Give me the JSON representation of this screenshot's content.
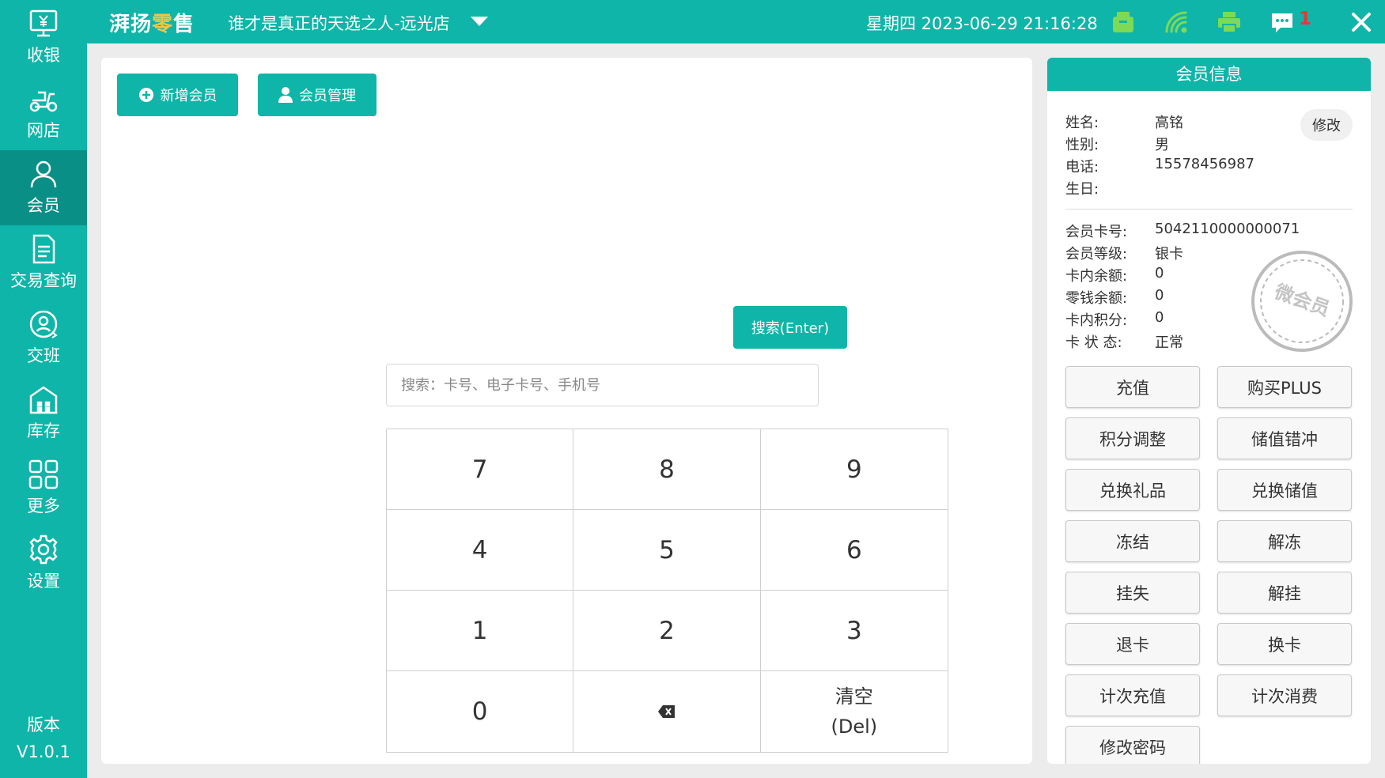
{
  "sidebar": {
    "items": [
      {
        "label": "收银",
        "icon": "cashier-monitor-icon"
      },
      {
        "label": "网店",
        "icon": "scooter-icon"
      },
      {
        "label": "会员",
        "icon": "member-person-icon",
        "active": true
      },
      {
        "label": "交易查询",
        "icon": "document-icon"
      },
      {
        "label": "交班",
        "icon": "shift-handover-icon"
      },
      {
        "label": "库存",
        "icon": "warehouse-icon"
      },
      {
        "label": "更多",
        "icon": "grid-icon"
      },
      {
        "label": "设置",
        "icon": "gear-icon"
      }
    ],
    "version_label": "版本",
    "version": "V1.0.1"
  },
  "header": {
    "brand": "湃扬零售",
    "store": "谁才是真正的天选之人-远光店",
    "datetime": "星期四 2023-06-29 21:16:28",
    "icons": [
      "cash-drawer-icon",
      "wifi-signal-icon",
      "printer-icon",
      "message-icon",
      "close-icon"
    ],
    "message_count": "1"
  },
  "main": {
    "add_member_label": "新增会员",
    "manage_member_label": "会员管理",
    "search_placeholder": "搜索：卡号、电子卡号、手机号",
    "search_button": "搜索(Enter)",
    "keypad": {
      "keys": [
        "7",
        "8",
        "9",
        "4",
        "5",
        "6",
        "1",
        "2",
        "3",
        "0"
      ],
      "clear_line1": "清空",
      "clear_line2": "(Del)"
    }
  },
  "member": {
    "title": "会员信息",
    "edit_label": "修改",
    "basic": [
      {
        "key": "姓名:",
        "value": "高铭"
      },
      {
        "key": "性别:",
        "value": "男"
      },
      {
        "key": "电话:",
        "value": "15578456987"
      },
      {
        "key": "生日:",
        "value": ""
      }
    ],
    "card": [
      {
        "key": "会员卡号:",
        "value": "5042110000000071"
      },
      {
        "key": "会员等级:",
        "value": "银卡"
      },
      {
        "key": "卡内余额:",
        "value": "0"
      },
      {
        "key": "零钱余额:",
        "value": "0"
      },
      {
        "key": "卡内积分:",
        "value": "0"
      },
      {
        "key": "卡 状 态:",
        "value": "正常"
      }
    ],
    "stamp_text": "微会员",
    "actions": [
      "充值",
      "购买PLUS",
      "积分调整",
      "储值错冲",
      "兑换礼品",
      "兑换储值",
      "冻结",
      "解冻",
      "挂失",
      "解挂",
      "退卡",
      "换卡",
      "计次充值",
      "计次消费",
      "修改密码"
    ]
  },
  "colors": {
    "accent": "#0fb5a8",
    "accent_dark": "#0a8f86",
    "brand_highlight": "#f6c343",
    "message_badge": "#e53935"
  }
}
